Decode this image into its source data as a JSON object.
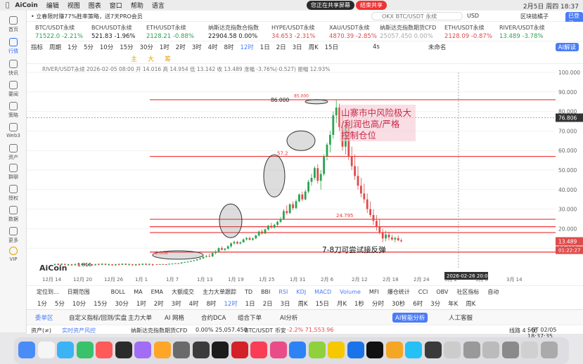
{
  "menubar": {
    "app": "AiCoin",
    "items": [
      "编辑",
      "视图",
      "图表",
      "窗口",
      "帮助",
      "语言"
    ],
    "share_text": "您正在共享屏幕",
    "stop_share": "结束共享",
    "datetime": "2月5日 周四 18:37"
  },
  "sidebar": [
    {
      "label": "首页"
    },
    {
      "label": "行情"
    },
    {
      "label": "快讯"
    },
    {
      "label": "要闻"
    },
    {
      "label": "策略"
    },
    {
      "label": "Web3"
    },
    {
      "label": "资产"
    },
    {
      "label": "群聊"
    },
    {
      "label": "授权"
    },
    {
      "label": "数据"
    },
    {
      "label": "更多"
    },
    {
      "label": "VIP"
    }
  ],
  "topbar": {
    "promo": "• 立春限时赚77%胜率策略，送7天PRO会员",
    "search_placeholder": "OKX BTC/USDT 永续",
    "currency": "USD",
    "exchange": "区块链橘子",
    "logged": "已登录"
  },
  "tickers": [
    {
      "name": "BTC/USDT永续",
      "value": "71522.0 -2.21%",
      "color": "#2aa44f"
    },
    {
      "name": "BCH/USDT永续",
      "value": "521.83 -1.96%",
      "color": "#222"
    },
    {
      "name": "ETH/USDT永续",
      "value": "2128.21 -0.88%",
      "color": "#2aa44f"
    },
    {
      "name": "纳斯达克指数合指数",
      "value": "22904.58 0.00%",
      "color": "#222"
    },
    {
      "name": "HYPE/USDT永续",
      "value": "34.653 -2.31%",
      "color": "#e04b4b"
    },
    {
      "name": "XAU/USDT永续",
      "value": "4870.39 -2.85%",
      "color": "#e04b4b"
    },
    {
      "name": "纳斯达克指数期货CFD",
      "value": "25057.450 0.00%",
      "color": "#aaa"
    },
    {
      "name": "ETH/USDT永续",
      "value": "2128.09 -0.87%",
      "color": "#e04b4b"
    },
    {
      "name": "RIVER/USDT永续",
      "value": "13.489 -3.78%",
      "color": "#2aa44f"
    }
  ],
  "toolbar": {
    "items": [
      "指标",
      "周期",
      "1分",
      "5分",
      "10分",
      "15分",
      "30分",
      "1时",
      "2时",
      "3时",
      "4时",
      "8时",
      "12时",
      "1日",
      "2日",
      "3日",
      "周K",
      "15日"
    ],
    "active": "12时",
    "right_tf": "4s",
    "right_label": "未命名",
    "ai": "AI解读"
  },
  "toolbar2": {
    "items": [
      "主",
      "大",
      "筹"
    ]
  },
  "pricetitle": "RIVER/USDT永续  2026-02-05 08:00  开 14.016  高 14.954  低 13.142  收 13.489  涨幅 -3.76%(-0.527)  振幅 12.93%",
  "chart_data": {
    "type": "candlestick",
    "title": "",
    "ylim": [
      0,
      100
    ],
    "y_ticks": [
      10,
      20,
      30,
      40,
      50,
      60,
      70,
      80,
      90,
      100
    ],
    "x_ticks": [
      "12月 14",
      "12月 20",
      "12月 26",
      "1月 1",
      "1月 7",
      "1月 13",
      "1月 19",
      "1月 25",
      "1月 31",
      "2月 6",
      "2月 12",
      "2月 18",
      "2月 24",
      "3月 2",
      "3月 8",
      "3月 14"
    ],
    "horizontal_levels": [
      86.0,
      57.0,
      24.795,
      21.0,
      18.0,
      8.0
    ],
    "price_labels": {
      "peak": "86.000",
      "mid": "57.2",
      "level": "24.795",
      "low": "6.006",
      "start": "1.816",
      "current": "13.489",
      "crosshair": "76.806",
      "countdown": "01:22:27",
      "top": "85.000"
    },
    "crosshair_date": "2026-02-26 20:00",
    "annotations": {
      "warning": "山寨市中风险极大/利润也高/严格控制仓位",
      "rebound": "7-8刀可尝试接反弹"
    },
    "watermark": "AiCoin",
    "candles": [
      [
        1.8,
        1.9,
        1.6,
        1.7
      ],
      [
        1.7,
        1.9,
        1.6,
        1.85
      ],
      [
        1.85,
        2.0,
        1.7,
        1.8
      ],
      [
        1.8,
        1.95,
        1.65,
        1.75
      ],
      [
        1.75,
        2.1,
        1.7,
        2.0
      ],
      [
        2.0,
        2.2,
        1.9,
        2.1
      ],
      [
        2.1,
        2.4,
        2.0,
        2.3
      ],
      [
        2.3,
        2.5,
        2.1,
        2.2
      ],
      [
        2.2,
        2.8,
        2.1,
        2.7
      ],
      [
        2.7,
        3.0,
        2.5,
        2.9
      ],
      [
        2.9,
        3.3,
        2.7,
        3.1
      ],
      [
        3.1,
        3.6,
        3.0,
        3.5
      ],
      [
        3.5,
        4.0,
        3.3,
        3.8
      ],
      [
        3.8,
        4.5,
        3.6,
        4.3
      ],
      [
        4.3,
        5.0,
        4.1,
        4.8
      ],
      [
        4.8,
        5.8,
        4.6,
        5.6
      ],
      [
        5.6,
        6.5,
        5.2,
        6.0
      ],
      [
        6.0,
        7.2,
        5.5,
        5.8
      ],
      [
        5.8,
        8.0,
        5.5,
        7.5
      ],
      [
        7.5,
        9.0,
        6.8,
        8.2
      ],
      [
        8.2,
        10.5,
        7.9,
        10.0
      ],
      [
        10.0,
        11.0,
        8.8,
        9.2
      ],
      [
        9.2,
        10.0,
        8.5,
        9.8
      ],
      [
        9.8,
        11.5,
        9.3,
        11.0
      ],
      [
        11.0,
        13.0,
        10.2,
        12.5
      ],
      [
        12.5,
        14.0,
        11.8,
        13.2
      ],
      [
        13.2,
        13.8,
        12.0,
        12.4
      ],
      [
        12.4,
        13.5,
        11.9,
        13.0
      ],
      [
        13.0,
        15.0,
        12.8,
        14.5
      ],
      [
        14.5,
        15.8,
        13.9,
        15.2
      ],
      [
        15.2,
        16.0,
        14.0,
        14.3
      ],
      [
        14.3,
        15.5,
        13.8,
        15.0
      ],
      [
        15.0,
        17.0,
        14.6,
        16.5
      ],
      [
        16.5,
        19.0,
        16.0,
        18.5
      ],
      [
        18.5,
        19.5,
        17.0,
        17.5
      ],
      [
        17.5,
        20.0,
        17.2,
        19.6
      ],
      [
        19.6,
        22.0,
        19.0,
        21.5
      ],
      [
        21.5,
        23.0,
        20.0,
        20.6
      ],
      [
        20.6,
        22.5,
        20.0,
        22.0
      ],
      [
        22.0,
        24.0,
        21.2,
        23.5
      ],
      [
        23.5,
        26.0,
        22.8,
        25.0
      ],
      [
        25.0,
        30.0,
        24.5,
        29.0
      ],
      [
        29.0,
        32.0,
        27.0,
        28.0
      ],
      [
        28.0,
        33.0,
        27.5,
        32.5
      ],
      [
        32.5,
        34.0,
        29.5,
        30.5
      ],
      [
        30.5,
        35.0,
        30.0,
        34.0
      ],
      [
        34.0,
        38.0,
        33.5,
        37.5
      ],
      [
        37.5,
        39.0,
        34.0,
        35.0
      ],
      [
        35.0,
        40.0,
        34.5,
        39.0
      ],
      [
        39.0,
        45.0,
        38.0,
        44.0
      ],
      [
        44.0,
        48.0,
        42.0,
        46.0
      ],
      [
        46.0,
        52.0,
        45.0,
        51.0
      ],
      [
        51.0,
        53.0,
        43.0,
        44.5
      ],
      [
        44.5,
        50.0,
        40.0,
        48.0
      ],
      [
        48.0,
        58.0,
        47.0,
        57.0
      ],
      [
        57.0,
        64.0,
        55.0,
        63.0
      ],
      [
        63.0,
        70.0,
        59.0,
        68.0
      ],
      [
        68.0,
        80.0,
        66.0,
        78.0
      ],
      [
        78.0,
        86.0,
        74.0,
        82.0
      ],
      [
        82.0,
        84.0,
        70.0,
        72.0
      ],
      [
        72.0,
        79.0,
        60.0,
        62.0
      ],
      [
        62.0,
        75.0,
        58.0,
        73.0
      ],
      [
        73.0,
        76.0,
        55.0,
        57.0
      ],
      [
        57.0,
        62.0,
        50.0,
        52.0
      ],
      [
        52.0,
        58.0,
        45.0,
        47.0
      ],
      [
        47.0,
        52.0,
        40.0,
        42.0
      ],
      [
        42.0,
        46.0,
        36.0,
        38.0
      ],
      [
        38.0,
        43.0,
        33.0,
        35.0
      ],
      [
        35.0,
        38.0,
        28.0,
        30.0
      ],
      [
        30.0,
        34.0,
        26.0,
        27.0
      ],
      [
        27.0,
        30.0,
        22.0,
        24.0
      ],
      [
        24.0,
        27.0,
        19.0,
        21.0
      ],
      [
        21.0,
        25.0,
        17.0,
        18.0
      ],
      [
        18.0,
        20.0,
        13.0,
        15.0
      ],
      [
        15.0,
        19.0,
        13.5,
        17.0
      ],
      [
        17.0,
        18.5,
        14.0,
        15.5
      ],
      [
        15.5,
        17.0,
        13.8,
        14.5
      ],
      [
        14.5,
        16.0,
        13.0,
        15.2
      ],
      [
        15.2,
        16.5,
        13.6,
        14.0
      ],
      [
        14.0,
        14.95,
        13.14,
        13.49
      ]
    ]
  },
  "bottomtabs": {
    "items": [
      "定位到...",
      "日期范围",
      "BOLL",
      "MA",
      "EMA",
      "大额成交",
      "主力大单跟踪",
      "TD",
      "BBI",
      "RSI",
      "KDJ",
      "MACD",
      "Volume",
      "MFI",
      "爆仓统计",
      "CCI",
      "OBV",
      "社区指标",
      "自动"
    ]
  },
  "periods": {
    "items": [
      "1分",
      "5分",
      "10分",
      "15分",
      "30分",
      "1时",
      "2时",
      "3时",
      "4时",
      "8时",
      "12时",
      "1日",
      "2日",
      "3日",
      "周K",
      "15日",
      "月K",
      "1秒",
      "分时",
      "30秒",
      "6时",
      "3分",
      "年K",
      "周K"
    ],
    "active": "12时"
  },
  "watchtabs": {
    "items": [
      "委单区",
      "自定义指标/回测/实盘",
      "主力大单",
      "AI 网格",
      "合约DCA",
      "组合下单",
      "AI分析"
    ],
    "right": "AI智能分析",
    "service": "人工客服"
  },
  "statusbar": {
    "asset": "资产(≠)",
    "risk": "实时资产风控",
    "nasdaq_label": "纳斯达克指数期货CFD",
    "nasdaq_val": "0.00%  25,057.450",
    "btc_label": "BTC/USDT 币安",
    "btc_val": "-2.2%  71,553.96",
    "lines": "线路 4 : 优",
    "time": "SGT 02/05 18:37:35"
  },
  "dock": {
    "count": 28
  }
}
